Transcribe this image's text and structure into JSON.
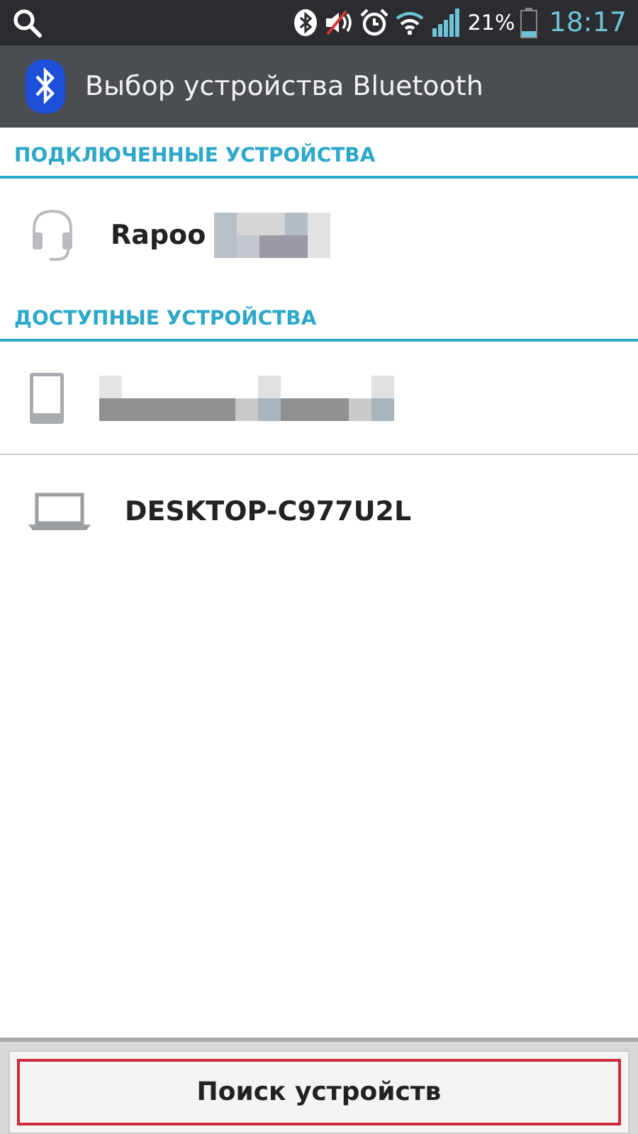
{
  "status_bar": {
    "battery_percent": "21%",
    "time": "18:17"
  },
  "header": {
    "title": "Выбор устройства Bluetooth"
  },
  "sections": [
    {
      "title": "ПОДКЛЮЧЕННЫЕ УСТРОЙСТВА",
      "devices": [
        {
          "kind": "headset",
          "name": "Rapoo",
          "redacted": true
        }
      ]
    },
    {
      "title": "ДОСТУПНЫЕ УСТРОЙСТВА",
      "devices": [
        {
          "kind": "phone",
          "redacted": true
        },
        {
          "kind": "laptop",
          "name": "DESKTOP-C977U2L",
          "redacted": false
        }
      ]
    }
  ],
  "scan_button": {
    "label": "Поиск устройств",
    "highlighted": true
  }
}
